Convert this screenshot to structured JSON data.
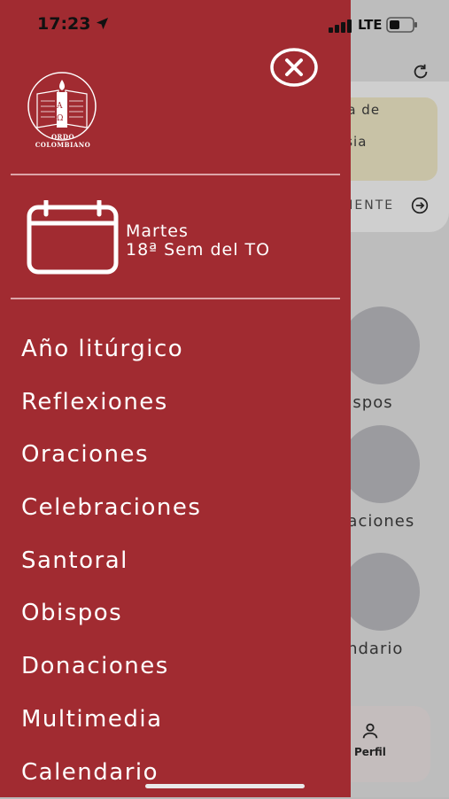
{
  "status_bar": {
    "time": "17:23",
    "network": "LTE"
  },
  "drawer": {
    "logo": {
      "line1": "ORDO",
      "line2": "COLOMBIANO",
      "alpha": "A",
      "omega": "Ω"
    },
    "date": {
      "day": "Martes",
      "week": "18ª Sem del TO"
    },
    "menu": [
      "Año litúrgico",
      "Reflexiones",
      "Oraciones",
      "Celebraciones",
      "Santoral",
      "Obispos",
      "Donaciones",
      "Multimedia",
      "Calendario"
    ]
  },
  "background": {
    "note_text": "ría de\n y\nesia",
    "next_label": "UIENTE",
    "items": [
      "bispos",
      "naciones",
      "endario"
    ],
    "tab_label": "Perfil"
  },
  "icons": [
    "location-arrow-icon",
    "signal-icon",
    "battery-icon",
    "close-icon",
    "calendar-icon",
    "refresh-icon",
    "arrow-right-circle-icon",
    "user-icon"
  ]
}
